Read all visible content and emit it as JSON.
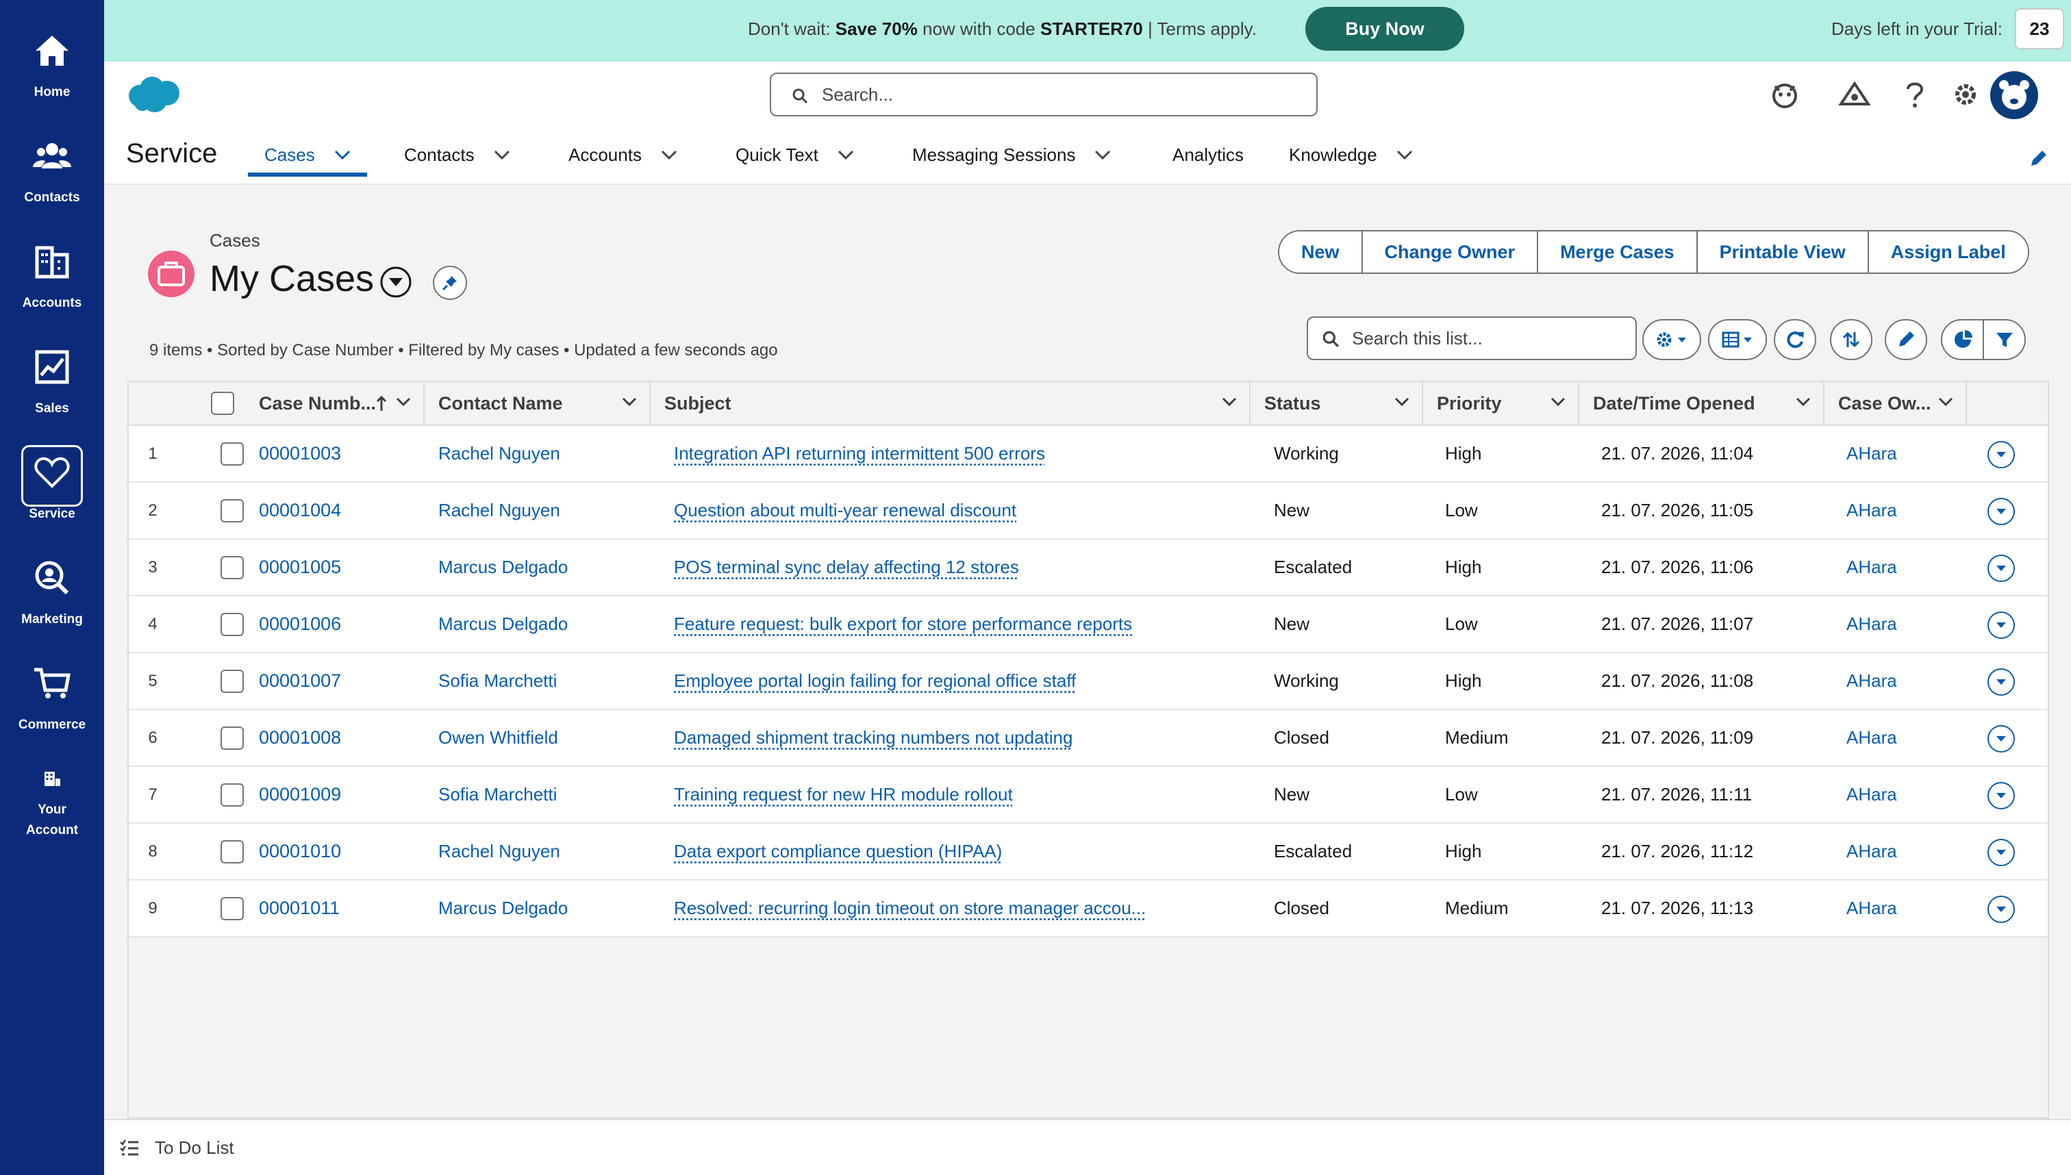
{
  "rail": {
    "items": [
      {
        "label": "Home",
        "icon": "home-icon"
      },
      {
        "label": "Contacts",
        "icon": "contacts-icon"
      },
      {
        "label": "Accounts",
        "icon": "accounts-icon"
      },
      {
        "label": "Sales",
        "icon": "sales-chart-icon"
      },
      {
        "label": "Service",
        "icon": "heart-icon",
        "active": true
      },
      {
        "label": "Marketing",
        "icon": "marketing-icon"
      },
      {
        "label": "Commerce",
        "icon": "cart-icon"
      },
      {
        "label": "Your Account",
        "icon": "building-icon"
      }
    ]
  },
  "promo": {
    "prefix": "Don't wait: ",
    "highlight": "Save 70%",
    "middle": " now with code ",
    "code": "STARTER70",
    "suffix": " | Terms apply.",
    "button": "Buy Now",
    "trial_label": "Days left in your Trial:",
    "trial_days": "23",
    "bg_color": "#b3efe2",
    "button_color": "#1b6a5f"
  },
  "header": {
    "search_placeholder": "Search...",
    "app_name": "Service",
    "tabs": [
      {
        "label": "Cases",
        "active": true,
        "dropdown": true
      },
      {
        "label": "Contacts",
        "dropdown": true
      },
      {
        "label": "Accounts",
        "dropdown": true
      },
      {
        "label": "Quick Text",
        "dropdown": true
      },
      {
        "label": "Messaging Sessions",
        "dropdown": true
      },
      {
        "label": "Analytics",
        "dropdown": false
      },
      {
        "label": "Knowledge",
        "dropdown": true
      }
    ],
    "utility_icons": [
      "einstein-icon",
      "trailhead-icon",
      "help-icon",
      "setup-gear-icon",
      "notifications-bell-icon",
      "avatar"
    ]
  },
  "list": {
    "breadcrumb": "Cases",
    "title": "My Cases",
    "actions": [
      "New",
      "Change Owner",
      "Merge Cases",
      "Printable View",
      "Assign Label"
    ],
    "meta": "9 items • Sorted by Case Number • Filtered by My cases • Updated a few seconds ago",
    "search_placeholder": "Search this list...",
    "columns": [
      "Case Numb...",
      "Contact Name",
      "Subject",
      "Status",
      "Priority",
      "Date/Time Opened",
      "Case Ow..."
    ],
    "rows": [
      {
        "n": "1",
        "case": "00001003",
        "contact": "Rachel Nguyen",
        "subject": "Integration API returning intermittent 500 errors",
        "status": "Working",
        "priority": "High",
        "opened": "21. 07. 2026, 11:04",
        "owner": "AHara"
      },
      {
        "n": "2",
        "case": "00001004",
        "contact": "Rachel Nguyen",
        "subject": "Question about multi-year renewal discount",
        "status": "New",
        "priority": "Low",
        "opened": "21. 07. 2026, 11:05",
        "owner": "AHara"
      },
      {
        "n": "3",
        "case": "00001005",
        "contact": "Marcus Delgado",
        "subject": "POS terminal sync delay affecting 12 stores",
        "status": "Escalated",
        "priority": "High",
        "opened": "21. 07. 2026, 11:06",
        "owner": "AHara"
      },
      {
        "n": "4",
        "case": "00001006",
        "contact": "Marcus Delgado",
        "subject": "Feature request: bulk export for store performance reports",
        "status": "New",
        "priority": "Low",
        "opened": "21. 07. 2026, 11:07",
        "owner": "AHara"
      },
      {
        "n": "5",
        "case": "00001007",
        "contact": "Sofia Marchetti",
        "subject": "Employee portal login failing for regional office staff",
        "status": "Working",
        "priority": "High",
        "opened": "21. 07. 2026, 11:08",
        "owner": "AHara"
      },
      {
        "n": "6",
        "case": "00001008",
        "contact": "Owen Whitfield",
        "subject": "Damaged shipment tracking numbers not updating",
        "status": "Closed",
        "priority": "Medium",
        "opened": "21. 07. 2026, 11:09",
        "owner": "AHara"
      },
      {
        "n": "7",
        "case": "00001009",
        "contact": "Sofia Marchetti",
        "subject": "Training request for new HR module rollout",
        "status": "New",
        "priority": "Low",
        "opened": "21. 07. 2026, 11:11",
        "owner": "AHara"
      },
      {
        "n": "8",
        "case": "00001010",
        "contact": "Rachel Nguyen",
        "subject": "Data export compliance question (HIPAA)",
        "status": "Escalated",
        "priority": "High",
        "opened": "21. 07. 2026, 11:12",
        "owner": "AHara"
      },
      {
        "n": "9",
        "case": "00001011",
        "contact": "Marcus Delgado",
        "subject": "Resolved: recurring login timeout on store manager accou...",
        "status": "Closed",
        "priority": "Medium",
        "opened": "21. 07. 2026, 11:13",
        "owner": "AHara"
      }
    ]
  },
  "utility_bar": {
    "todo": "To Do List"
  },
  "colors": {
    "rail": "#0b2b7a",
    "link": "#0b5cab",
    "case_icon": "#f05f85"
  }
}
